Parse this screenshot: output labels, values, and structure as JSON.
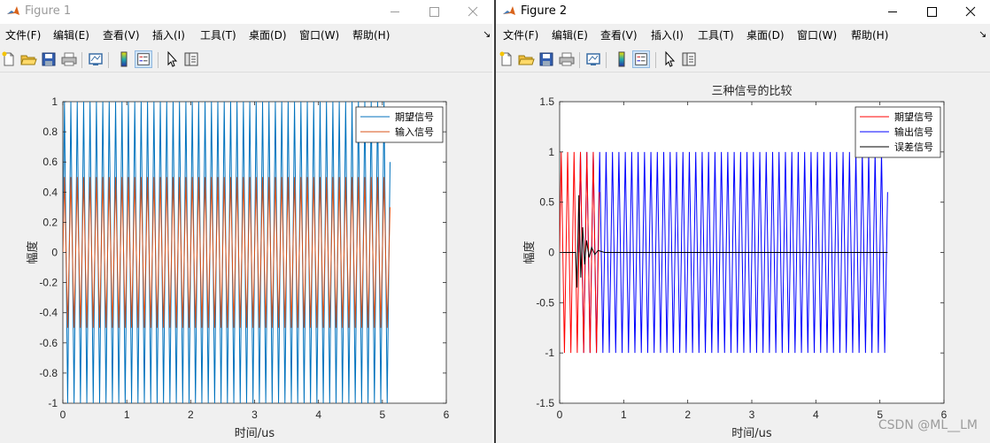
{
  "windows": [
    {
      "title": "Figure 1",
      "menu": [
        "文件(F)",
        "编辑(E)",
        "查看(V)",
        "插入(I)",
        "工具(T)",
        "桌面(D)",
        "窗口(W)",
        "帮助(H)"
      ],
      "menu_overflow": "↘",
      "toolbar_icons": [
        "new-figure-icon",
        "open-file-icon",
        "save-icon",
        "print-icon",
        "link-plot-icon",
        "insert-colorbar-icon",
        "insert-legend-icon",
        "edit-plot-icon",
        "property-inspector-icon"
      ]
    },
    {
      "title": "Figure 2",
      "menu": [
        "文件(F)",
        "编辑(E)",
        "查看(V)",
        "插入(I)",
        "工具(T)",
        "桌面(D)",
        "窗口(W)",
        "帮助(H)"
      ],
      "menu_overflow": "↘",
      "toolbar_icons": [
        "new-figure-icon",
        "open-file-icon",
        "save-icon",
        "print-icon",
        "link-plot-icon",
        "insert-colorbar-icon",
        "insert-legend-icon",
        "edit-plot-icon",
        "property-inspector-icon"
      ]
    }
  ],
  "watermark": "CSDN @ML__LM",
  "colors": {
    "series_blue": "#0072BD",
    "series_orange": "#D95319",
    "red": "#FF0000",
    "blue": "#0000FF",
    "black": "#000000"
  },
  "chart_data": [
    {
      "type": "line",
      "title": "",
      "xlabel": "时间/us",
      "ylabel": "幅度",
      "xlim": [
        0,
        6
      ],
      "ylim": [
        -1,
        1
      ],
      "xticks": [
        "0",
        "1",
        "2",
        "3",
        "4",
        "5",
        "6"
      ],
      "yticks": [
        "-1",
        "-0.8",
        "-0.6",
        "-0.4",
        "-0.2",
        "0",
        "0.2",
        "0.4",
        "0.6",
        "0.8",
        "1"
      ],
      "legend_position": "top-right",
      "series": [
        {
          "name": "期望信号",
          "color": "#0072BD",
          "amplitude": 1.0,
          "frequency_per_us": 10,
          "x_start": 0,
          "x_end": 5.12
        },
        {
          "name": "输入信号",
          "color": "#D95319",
          "amplitude": 0.5,
          "frequency_per_us": 10,
          "x_start": 0,
          "x_end": 5.12
        }
      ]
    },
    {
      "type": "line",
      "title": "三种信号的比较",
      "xlabel": "时间/us",
      "ylabel": "幅度",
      "xlim": [
        0,
        6
      ],
      "ylim": [
        -1.5,
        1.5
      ],
      "xticks": [
        "0",
        "1",
        "2",
        "3",
        "4",
        "5",
        "6"
      ],
      "yticks": [
        "-1.5",
        "-1",
        "-0.5",
        "0",
        "0.5",
        "1",
        "1.5"
      ],
      "legend_position": "top-right",
      "series": [
        {
          "name": "期望信号",
          "color": "#FF0000",
          "amplitude": 1.0,
          "frequency_per_us": 10,
          "x_start": 0,
          "x_end": 0.62
        },
        {
          "name": "输出信号",
          "color": "#0000FF",
          "amplitude": 1.0,
          "frequency_per_us": 10,
          "x_start": 0.3,
          "x_end": 5.12
        },
        {
          "name": "误差信号",
          "color": "#000000",
          "x_start": 0,
          "x_end": 5.12,
          "transient_peak": 0.57,
          "transient_end": 0.7,
          "steady_value": 0
        }
      ]
    }
  ]
}
